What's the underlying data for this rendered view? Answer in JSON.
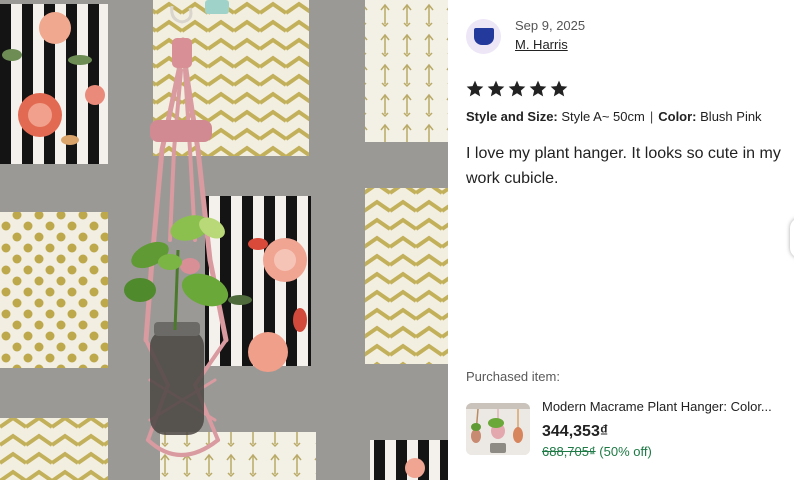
{
  "review": {
    "date": "Sep 9, 2025",
    "reviewer": "M. Harris",
    "rating": 5,
    "max_rating": 5,
    "style_label": "Style and Size:",
    "style_value": "Style A~ 50cm",
    "separator": "|",
    "color_label": "Color:",
    "color_value": "Blush Pink",
    "text": "I love my plant hanger. It looks so cute in my work cubicle."
  },
  "purchased": {
    "label": "Purchased item:",
    "title": "Modern Macrame Plant Hanger: Color...",
    "price": "344,353₫",
    "original_price": "688,705₫",
    "discount": "(50% off)"
  },
  "colors": {
    "star": "#222222",
    "discount_green": "#1e7a45",
    "avatar_bg": "#ede6f7",
    "avatar_icon": "#23399c",
    "macrame_pink": "#d99aa0"
  }
}
